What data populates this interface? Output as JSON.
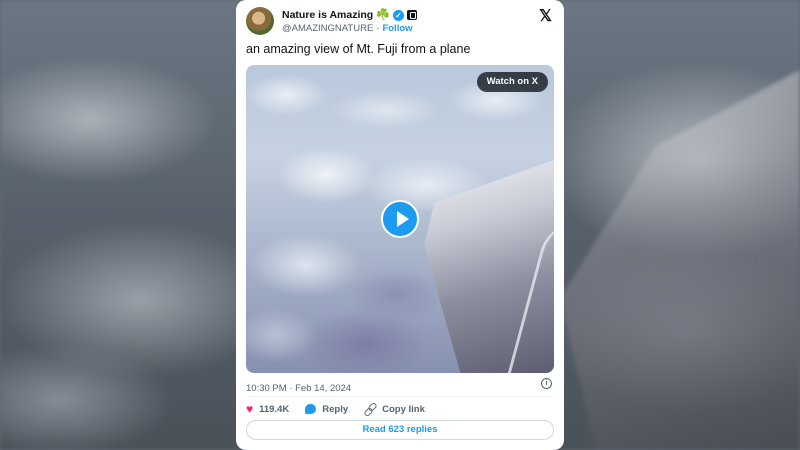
{
  "tweet": {
    "author_name": "Nature is Amazing",
    "author_emoji": "☘️",
    "handle": "@AMAZINGNATURE",
    "separator": "·",
    "follow_label": "Follow",
    "text": "an amazing view of Mt. Fuji from a plane",
    "watch_label": "Watch on X",
    "timestamp": "10:30 PM · Feb 14, 2024",
    "likes": "119.4K",
    "reply_label": "Reply",
    "copy_link_label": "Copy link",
    "read_replies_label": "Read 623 replies"
  },
  "icons": {
    "logo": "x-logo-icon",
    "verified": "verified-badge-icon",
    "affiliate": "affiliate-badge-icon",
    "play": "play-icon",
    "info": "info-icon",
    "like": "heart-icon",
    "reply": "reply-bubble-icon",
    "link": "link-icon"
  },
  "colors": {
    "accent": "#1d9bf0",
    "like": "#f91880",
    "text": "#0f1419",
    "muted": "#536471"
  }
}
